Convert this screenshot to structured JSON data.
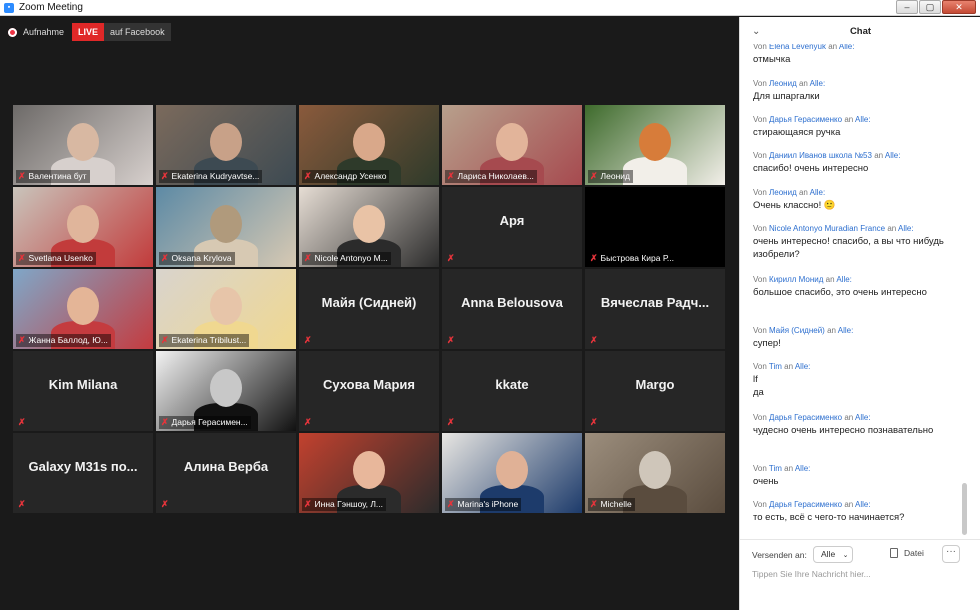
{
  "window": {
    "title": "Zoom Meeting",
    "minimize": "–",
    "maximize": "▢",
    "close": "✕"
  },
  "recording": {
    "label": "Aufnahme",
    "live": "LIVE",
    "destination": "auf Facebook"
  },
  "tiles": [
    {
      "name": "Валентина бут",
      "type": "video",
      "palette": [
        "#6d6a68",
        "#d8b8a2",
        "#d7d0cd"
      ]
    },
    {
      "name": "Ekaterina Kudryavtse...",
      "type": "video",
      "active": true,
      "palette": [
        "#7b6a5c",
        "#c8a188",
        "#3d4a52"
      ]
    },
    {
      "name": "Александр Усенко",
      "type": "video",
      "palette": [
        "#8a5a3c",
        "#d9a88a",
        "#2e3a2a"
      ]
    },
    {
      "name": "Лариса Николаев...",
      "type": "video",
      "palette": [
        "#b7a08c",
        "#e2b49a",
        "#a64a4f"
      ]
    },
    {
      "name": "Леонид",
      "type": "video",
      "palette": [
        "#3e6b2c",
        "#d77c3a",
        "#f2efe9"
      ]
    },
    {
      "name": "Svetlana Usenko",
      "type": "video",
      "palette": [
        "#c9c4bb",
        "#e0b59b",
        "#c23b3b"
      ]
    },
    {
      "name": "Oksana Krylova",
      "type": "video",
      "palette": [
        "#5d8aa5",
        "#b09a7c",
        "#d7c9b3"
      ]
    },
    {
      "name": "Nicole Antonyo M...",
      "type": "video",
      "palette": [
        "#e6ddd4",
        "#e9c3a6",
        "#2b2b2b"
      ]
    },
    {
      "name": "Аря",
      "type": "name"
    },
    {
      "name": "Быстрова Кира Р...",
      "type": "black"
    },
    {
      "name": "Жанна Баллод, Ю...",
      "type": "video",
      "palette": [
        "#7fa7c8",
        "#e4b597",
        "#c43b3f"
      ]
    },
    {
      "name": "Ekaterina Tribilust...",
      "type": "video",
      "palette": [
        "#d9d4cd",
        "#e7c5a9",
        "#f0d890"
      ]
    },
    {
      "name": "Майя (Сидней)",
      "type": "name"
    },
    {
      "name": "Anna Belousova",
      "type": "name"
    },
    {
      "name": "Вячеслав Радч...",
      "type": "name"
    },
    {
      "name": "Kim Milana",
      "type": "name"
    },
    {
      "name": "Дарья Герасимен...",
      "type": "video",
      "palette": [
        "#f2f2f2",
        "#c8c8c8",
        "#111111"
      ]
    },
    {
      "name": "Сухова Мария",
      "type": "name"
    },
    {
      "name": "kkate",
      "type": "name"
    },
    {
      "name": "Margo",
      "type": "name"
    },
    {
      "name": "Galaxy M31s по...",
      "type": "name"
    },
    {
      "name": "Алина Верба",
      "type": "name"
    },
    {
      "name": "Инна Гэншоу, Л...",
      "type": "video",
      "palette": [
        "#c2412e",
        "#e8b79b",
        "#2b2b2b"
      ]
    },
    {
      "name": "Marina's iPhone",
      "type": "video",
      "palette": [
        "#e8e6e2",
        "#e0b196",
        "#1d3b6b"
      ]
    },
    {
      "name": "Michelle",
      "type": "video",
      "palette": [
        "#9c8e7d",
        "#cfc6ba",
        "#5a4c3e"
      ]
    }
  ],
  "chat": {
    "title": "Chat",
    "messages": [
      {
        "from": "Elena Levenyuk",
        "text": "отмычка"
      },
      {
        "from": "Леонид",
        "text": "Для шпаргалки"
      },
      {
        "from": "Дарья Герасименко",
        "text": "стирающаяся ручка"
      },
      {
        "from": "Даниил Иванов школа №53",
        "text": "спасибо! очень интересно"
      },
      {
        "from": "Леонид",
        "text": "Очень классно! 🙂"
      },
      {
        "from": "Nicole Antonyo Muradian France",
        "text": "очень интересно! спасибо, а вы что нибудь изобрели?"
      },
      {
        "from": "Кирилл Монид",
        "text": "большое спасибо, это очень интересно"
      },
      {
        "from": "Майя (Сидней)",
        "text": "супер!"
      },
      {
        "from": "Tim",
        "text": "lf\nда"
      },
      {
        "from": "Дарья Герасименко",
        "text": "чудесно очень интересно познавательно"
      },
      {
        "from": "Tim",
        "text": "очень"
      },
      {
        "from": "Дарья Герасименко",
        "text": "то есть, всё с чего-то начинается?"
      }
    ],
    "from_prefix": "Von",
    "to_word": "an",
    "to_target": "Alle:",
    "send_to_label": "Versenden an:",
    "send_to_value": "Alle",
    "file_label": "Datei",
    "more_label": "···",
    "input_placeholder": "Tippen Sie Ihre Nachricht hier..."
  }
}
